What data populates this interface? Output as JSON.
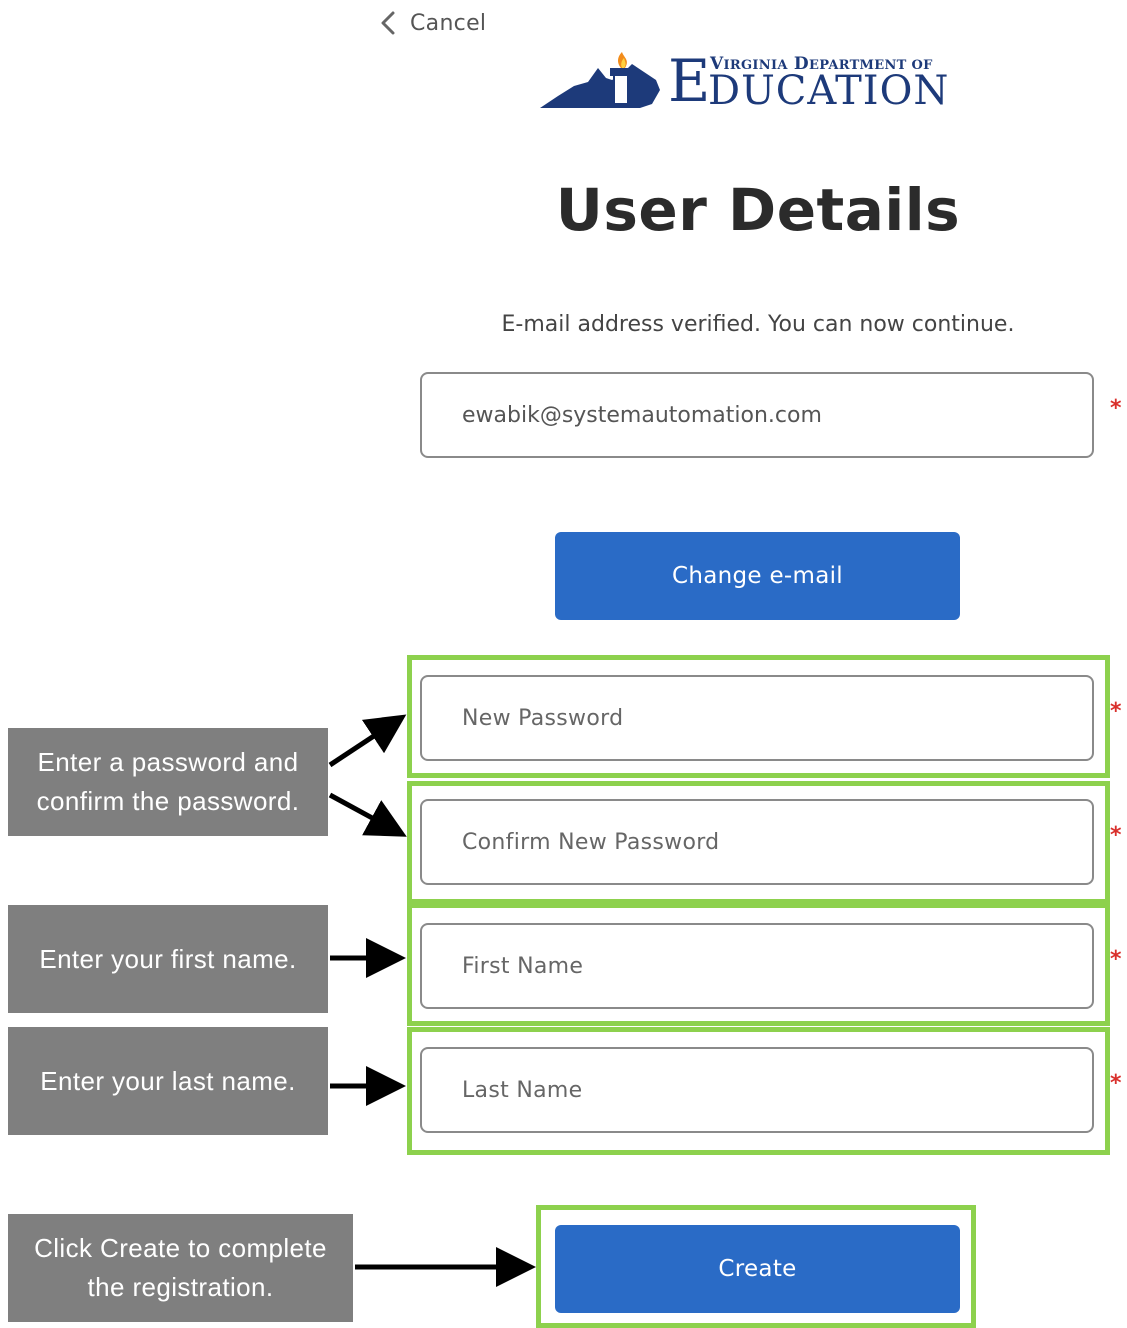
{
  "header": {
    "cancel_label": "Cancel",
    "logo": {
      "icon": "virginia-torch-logo",
      "line1": "Virginia Department of",
      "line2": "Education",
      "color": "#1d3a7a"
    }
  },
  "page": {
    "title": "User Details",
    "verified_message": "E-mail address verified. You can now continue."
  },
  "form": {
    "email_value": "ewabik@systemautomation.com",
    "change_email_label": "Change e-mail",
    "new_password_placeholder": "New Password",
    "confirm_password_placeholder": "Confirm New Password",
    "first_name_placeholder": "First Name",
    "last_name_placeholder": "Last Name",
    "required_marker": "*",
    "create_label": "Create"
  },
  "callouts": {
    "password_line1": "Enter a password and",
    "password_line2": "confirm the password.",
    "first_name": "Enter your first name.",
    "last_name": "Enter your last name.",
    "create_line1": "Click Create to complete",
    "create_line2": "the registration."
  },
  "colors": {
    "primary_button": "#2a6bc6",
    "highlight": "#8dd14d",
    "callout_bg": "#7f7f7f",
    "required": "#d9302c"
  }
}
